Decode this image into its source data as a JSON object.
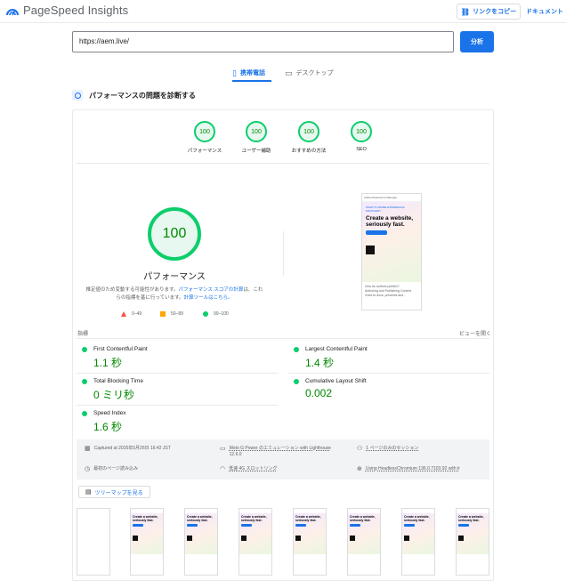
{
  "header": {
    "app_name": "PageSpeed Insights",
    "copy_link_label": "リンクをコピー",
    "docs_label": "ドキュメント"
  },
  "search": {
    "url_value": "https://aem.live/",
    "analyze_label": "分析"
  },
  "tabs": [
    {
      "label": "携帯電話",
      "active": true
    },
    {
      "label": "デスクトップ",
      "active": false
    }
  ],
  "diagnose_title": "パフォーマンスの問題を診断する",
  "summary_scores": [
    {
      "score": "100",
      "label": "パフォーマンス"
    },
    {
      "score": "100",
      "label": "ユーザー補助"
    },
    {
      "score": "100",
      "label": "おすすめの方法"
    },
    {
      "score": "100",
      "label": "SEO"
    }
  ],
  "performance": {
    "score": "100",
    "label": "パフォーマンス",
    "note_prefix": "推定値のため変動する可能性があります。",
    "note_link1": "パフォーマンス スコアの計算",
    "note_mid": "は、これらの指標を基に行っています。",
    "note_link2": "計算ツールはこちら。",
    "legend": [
      {
        "range": "0–49",
        "color": "#ff4e42"
      },
      {
        "range": "50–89",
        "color": "#ffa400"
      },
      {
        "range": "90–100",
        "color": "#0cce6b"
      }
    ]
  },
  "preview": {
    "topbar": "Adobe Experience Manager",
    "subtitle": "WHAT IS ADOBE EXPERIENCE MANAGER?",
    "headline": "Create a website, seriously fast.",
    "footer1": "How do authors publish?",
    "footer2": "Authoring and Publishing Content",
    "footer3": "Goes to docs, previews and..."
  },
  "metrics": {
    "header": "指標",
    "expand_label": "ビューを開く",
    "items": [
      {
        "name": "First Contentful Paint",
        "value": "1.1 秒"
      },
      {
        "name": "Largest Contentful Paint",
        "value": "1.4 秒"
      },
      {
        "name": "Total Blocking Time",
        "value": "0 ミリ秒"
      },
      {
        "name": "Cumulative Layout Shift",
        "value": "0.002"
      },
      {
        "name": "Speed Index",
        "value": "1.6 秒"
      }
    ]
  },
  "environment": {
    "captured": "Captured at 2025年5月26日 16:42 JST",
    "device": "Moto G Power のエミュレーション with Lighthouse",
    "device_version": "12.6.0",
    "session": "1 ページのみのセッション",
    "initial_load": "最初のページ読み込み",
    "network": "低速 4G スロットリング",
    "browser": "Using HeadlessChromium 136.0.7103.92 with lr"
  },
  "treemap_label": "ツリーマップを見る",
  "thumbnail_headline": "Create a website, seriously fast."
}
